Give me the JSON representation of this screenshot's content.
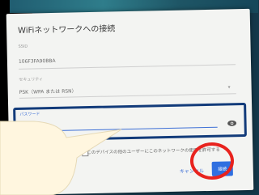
{
  "dialog": {
    "title": "WiFiネットワークへの接続",
    "ssid_label": "SSID",
    "ssid_value": "106F3FA90BBA",
    "security_label": "セキュリティ",
    "security_value": "PSK（WPA または RSN）",
    "password_label": "パスワード",
    "password_value": "••••••••••",
    "share_label": "このデバイスの他のユーザーにこのネットワークの使用を許可する",
    "cancel_label": "キャンセル",
    "connect_label": "接続"
  },
  "colors": {
    "highlight_box": "#123b7a",
    "red_circle": "#e8231e",
    "primary": "#2f6fe0"
  },
  "icons": {
    "password_toggle": "eye-icon",
    "dropdown": "chevron-down-icon"
  }
}
